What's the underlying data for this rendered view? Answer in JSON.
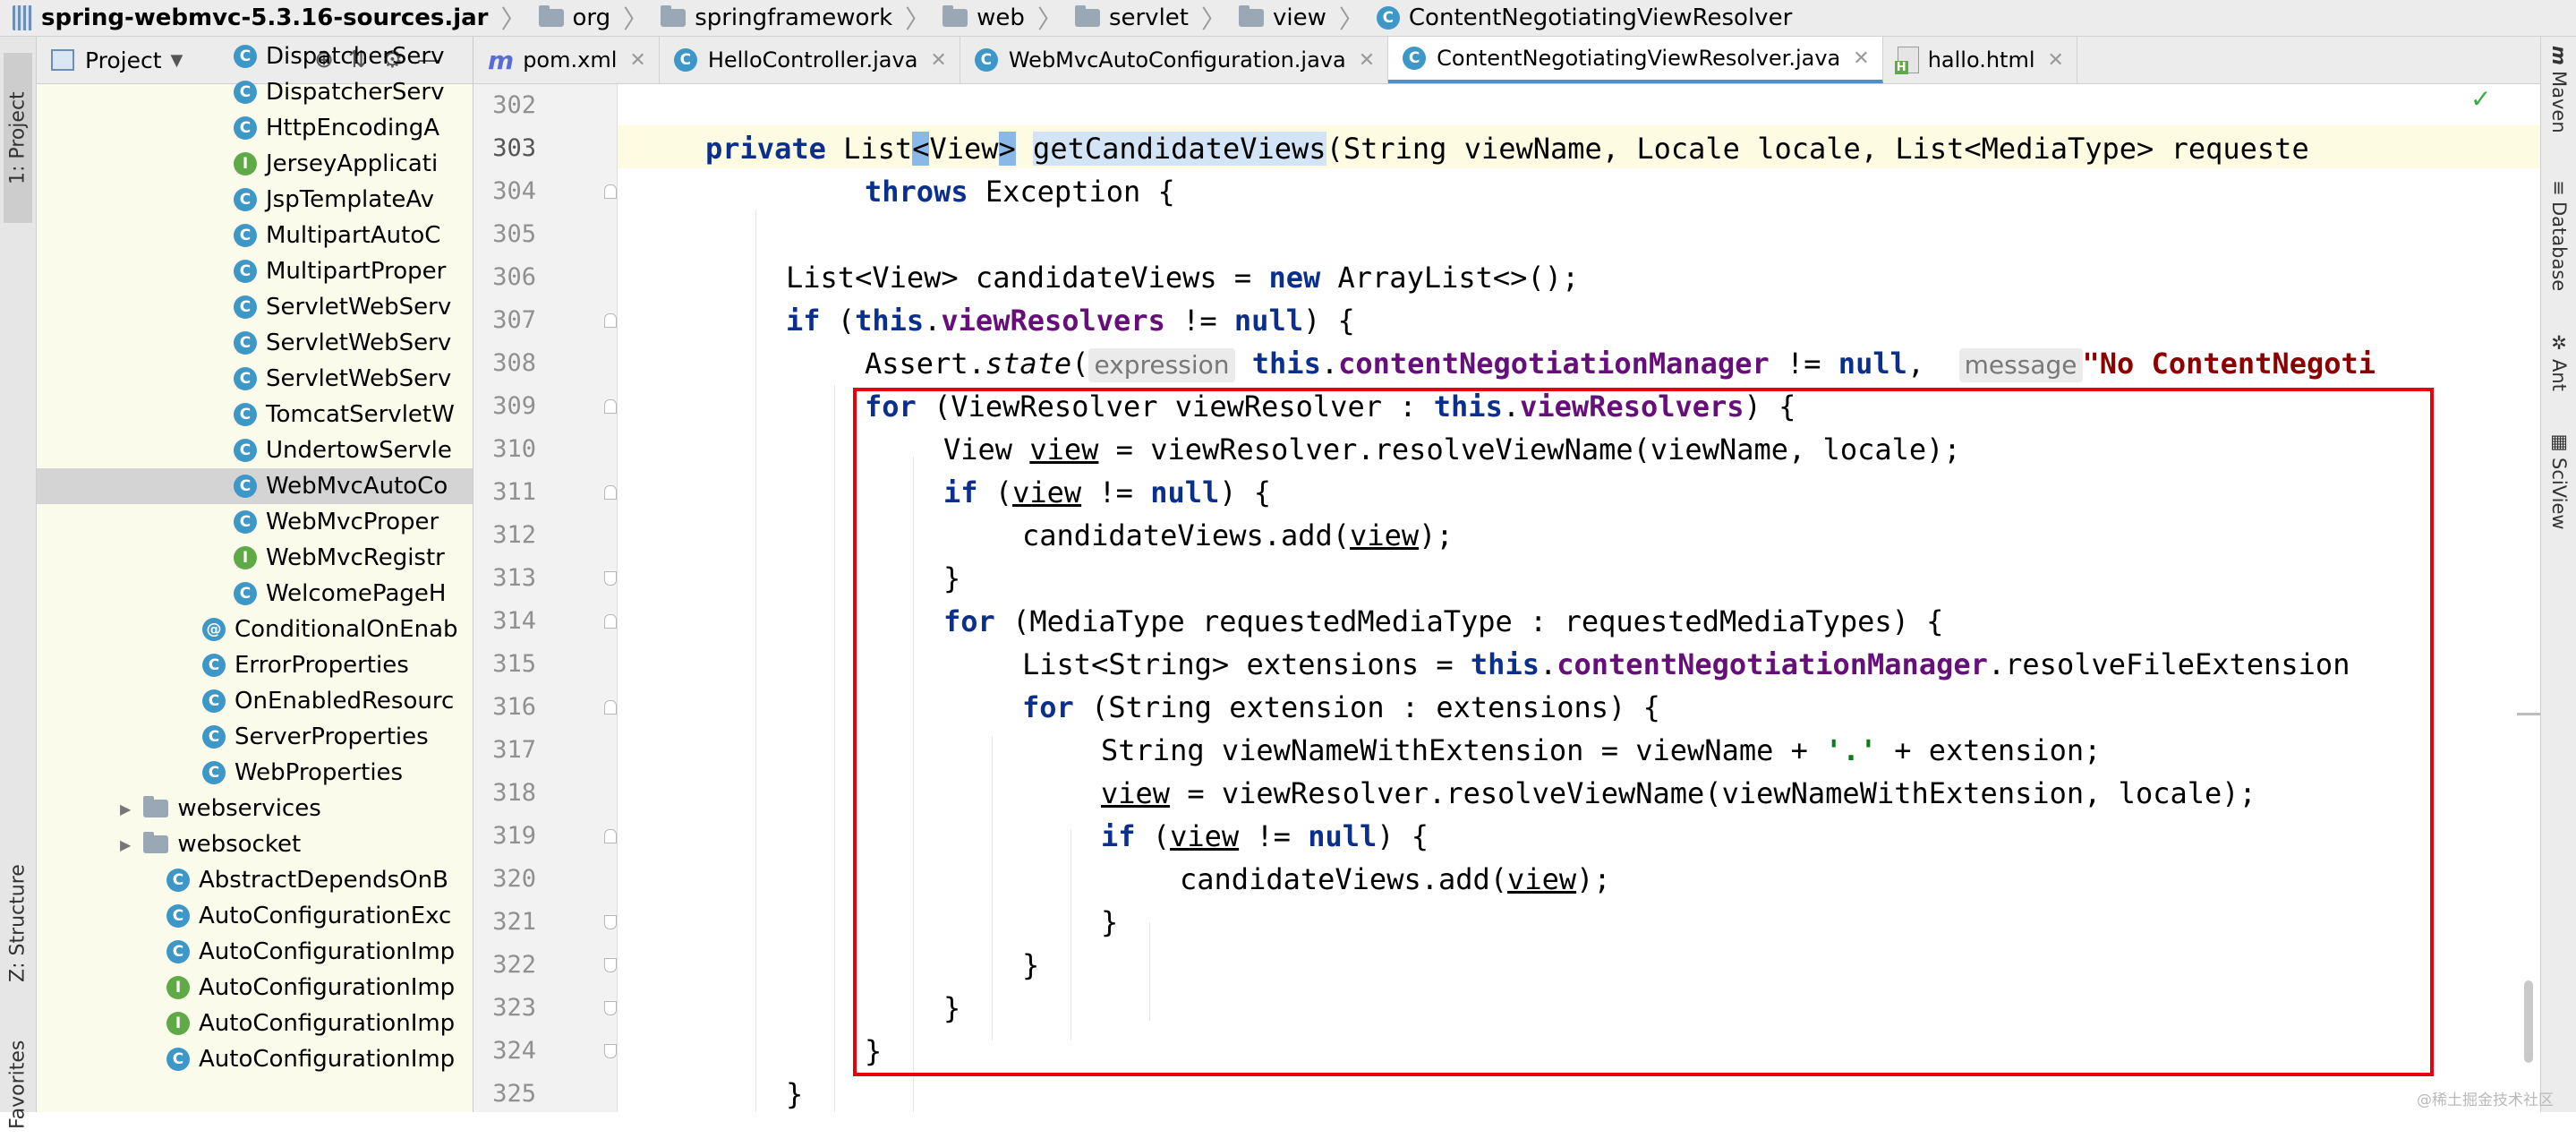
{
  "breadcrumb": [
    {
      "label": "spring-webmvc-5.3.16-sources.jar",
      "icon": "jar-icon"
    },
    {
      "label": "org",
      "icon": "folder-icon"
    },
    {
      "label": "springframework",
      "icon": "folder-icon"
    },
    {
      "label": "web",
      "icon": "folder-icon"
    },
    {
      "label": "servlet",
      "icon": "folder-icon"
    },
    {
      "label": "view",
      "icon": "folder-icon"
    },
    {
      "label": "ContentNegotiatingViewResolver",
      "icon": "class-icon"
    }
  ],
  "left_stripe": {
    "project": "1: Project",
    "structure": "Z: Structure",
    "favorites": "Favorites"
  },
  "project_panel": {
    "title": "Project",
    "items": [
      {
        "label": "DispatcherServ",
        "type": "C"
      },
      {
        "label": "DispatcherServ",
        "type": "C"
      },
      {
        "label": "HttpEncodingA",
        "type": "C"
      },
      {
        "label": "JerseyApplicati",
        "type": "I"
      },
      {
        "label": "JspTemplateAv",
        "type": "C"
      },
      {
        "label": "MultipartAutoC",
        "type": "C"
      },
      {
        "label": "MultipartProper",
        "type": "C"
      },
      {
        "label": "ServletWebServ",
        "type": "C"
      },
      {
        "label": "ServletWebServ",
        "type": "C"
      },
      {
        "label": "ServletWebServ",
        "type": "C"
      },
      {
        "label": "TomcatServletW",
        "type": "C"
      },
      {
        "label": "UndertowServle",
        "type": "C"
      },
      {
        "label": "WebMvcAutoCo",
        "type": "C",
        "selected": true
      },
      {
        "label": "WebMvcProper",
        "type": "C"
      },
      {
        "label": "WebMvcRegistr",
        "type": "I"
      },
      {
        "label": "WelcomePageH",
        "type": "C"
      },
      {
        "label": "ConditionalOnEnab",
        "type": "@"
      },
      {
        "label": "ErrorProperties",
        "type": "C"
      },
      {
        "label": "OnEnabledResourc",
        "type": "C"
      },
      {
        "label": "ServerProperties",
        "type": "C"
      },
      {
        "label": "WebProperties",
        "type": "C"
      },
      {
        "label": "webservices",
        "type": "folder"
      },
      {
        "label": "websocket",
        "type": "folder"
      },
      {
        "label": "AbstractDependsOnB",
        "type": "C"
      },
      {
        "label": "AutoConfigurationExc",
        "type": "C"
      },
      {
        "label": "AutoConfigurationImp",
        "type": "C"
      },
      {
        "label": "AutoConfigurationImp",
        "type": "I"
      },
      {
        "label": "AutoConfigurationImp",
        "type": "I"
      },
      {
        "label": "AutoConfigurationImp",
        "type": "C"
      }
    ]
  },
  "tabs": [
    {
      "label": "pom.xml",
      "icon": "maven-icon"
    },
    {
      "label": "HelloController.java",
      "icon": "class-icon"
    },
    {
      "label": "WebMvcAutoConfiguration.java",
      "icon": "class-icon"
    },
    {
      "label": "ContentNegotiatingViewResolver.java",
      "icon": "class-icon",
      "active": true
    },
    {
      "label": "hallo.html",
      "icon": "html-icon"
    }
  ],
  "right_stripe": [
    "Maven",
    "Database",
    "Ant",
    "SciView"
  ],
  "line_numbers": [
    "302",
    "303",
    "304",
    "305",
    "306",
    "307",
    "308",
    "309",
    "310",
    "311",
    "312",
    "313",
    "314",
    "315",
    "316",
    "317",
    "318",
    "319",
    "320",
    "321",
    "322",
    "323",
    "324",
    "325"
  ],
  "code": {
    "l303": {
      "kw": "private",
      "t1": "List",
      "lt": "<",
      "type": "View",
      "gt": ">",
      "method": "getCandidateViews",
      "rest": "(String viewName, Locale locale, List<MediaType> requeste"
    },
    "l304": {
      "kw": "throws",
      "rest": " Exception {"
    },
    "l306": {
      "a": "List<View> candidateViews = ",
      "kw": "new",
      "b": " ArrayList<>();"
    },
    "l307": {
      "kw": "if",
      "a": " (",
      "kw2": "this",
      "dot": ".",
      "fld": "viewResolvers",
      "b": " != ",
      "nul": "null",
      "c": ") {"
    },
    "l308": {
      "a": "Assert.",
      "it": "state",
      "b": "(",
      "hint1": "expression",
      "kw2": "this",
      "dot": ".",
      "fld": "contentNegotiationManager",
      "c": " != ",
      "nul": "null",
      "d": ",  ",
      "hint2": "message",
      "str": "\"No ContentNegoti"
    },
    "l309": {
      "kw": "for",
      "a": " (ViewResolver viewResolver : ",
      "kw2": "this",
      "dot": ".",
      "fld": "viewResolvers",
      "b": ") {"
    },
    "l310": {
      "a": "View ",
      "ul": "view",
      "b": " = viewResolver.resolveViewName(viewName, locale);"
    },
    "l311": {
      "kw": "if",
      "a": " (",
      "ul": "view",
      "b": " != ",
      "nul": "null",
      "c": ") {"
    },
    "l312": {
      "a": "candidateViews.add(",
      "ul": "view",
      "b": ");"
    },
    "l313": {
      "a": "}"
    },
    "l314": {
      "kw": "for",
      "a": " (MediaType requestedMediaType : requestedMediaTypes) {"
    },
    "l315": {
      "a": "List<String> extensions = ",
      "kw2": "this",
      "dot": ".",
      "fld": "contentNegotiationManager",
      "b": ".resolveFileExtension"
    },
    "l316": {
      "kw": "for",
      "a": " (String extension : extensions) {"
    },
    "l317": {
      "a": "String viewNameWithExtension = viewName + ",
      "str": "'.'",
      "b": " + extension;"
    },
    "l318": {
      "ul": "view",
      "a": " = viewResolver.resolveViewName(viewNameWithExtension, locale);"
    },
    "l319": {
      "kw": "if",
      "a": " (",
      "ul": "view",
      "b": " != ",
      "nul": "null",
      "c": ") {"
    },
    "l320": {
      "a": "candidateViews.add(",
      "ul": "view",
      "b": ");"
    },
    "l321": {
      "a": "}"
    },
    "l322": {
      "a": "}"
    },
    "l323": {
      "a": "}"
    },
    "l324": {
      "a": "}"
    },
    "l325": {
      "a": "}"
    }
  },
  "watermark": "@稀土掘金技术社区",
  "colors": {
    "selection_box": "#e8000b",
    "keyword": "#0b2f8c",
    "field": "#660e7a",
    "string": "#067d17",
    "current_line": "#fdfbe2"
  }
}
